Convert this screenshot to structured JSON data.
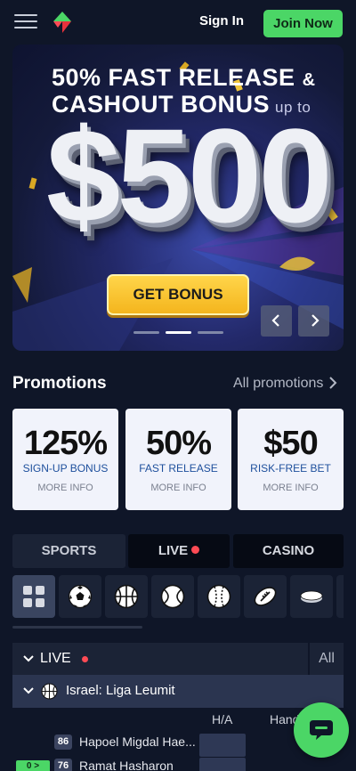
{
  "header": {
    "sign_in": "Sign In",
    "join_now": "Join Now",
    "accent": "#4bd666"
  },
  "banner": {
    "line1": "50% FAST RELEASE",
    "line1_amp": "&",
    "line2": "CASHOUT BONUS",
    "line2_suffix": "up to",
    "amount": "$500",
    "cta": "GET BONUS",
    "slide_count": 3,
    "active_slide": 2
  },
  "promotions": {
    "title": "Promotions",
    "all_link": "All promotions",
    "cards": [
      {
        "value": "125%",
        "label": "SIGN-UP BONUS",
        "more": "MORE INFO"
      },
      {
        "value": "50%",
        "label": "FAST RELEASE",
        "more": "MORE INFO"
      },
      {
        "value": "$50",
        "label": "RISK-FREE BET",
        "more": "MORE INFO"
      }
    ]
  },
  "tabs": {
    "sports": "SPORTS",
    "live": "LIVE",
    "casino": "CASINO"
  },
  "sports_icons": [
    "grid-icon",
    "soccer-icon",
    "basketball-icon",
    "tennis-icon",
    "baseball-icon",
    "football-icon",
    "hockey-icon"
  ],
  "live_section": {
    "label": "LIVE",
    "all": "All",
    "league": "Israel: Liga Leumit",
    "col_ha": "H/A",
    "col_hand": "Hand",
    "teams": [
      {
        "num": "86",
        "name": "Hapoel Migdal Hae...",
        "score": ""
      },
      {
        "num": "76",
        "name": "Ramat Hasharon",
        "score": "0 >"
      }
    ]
  }
}
